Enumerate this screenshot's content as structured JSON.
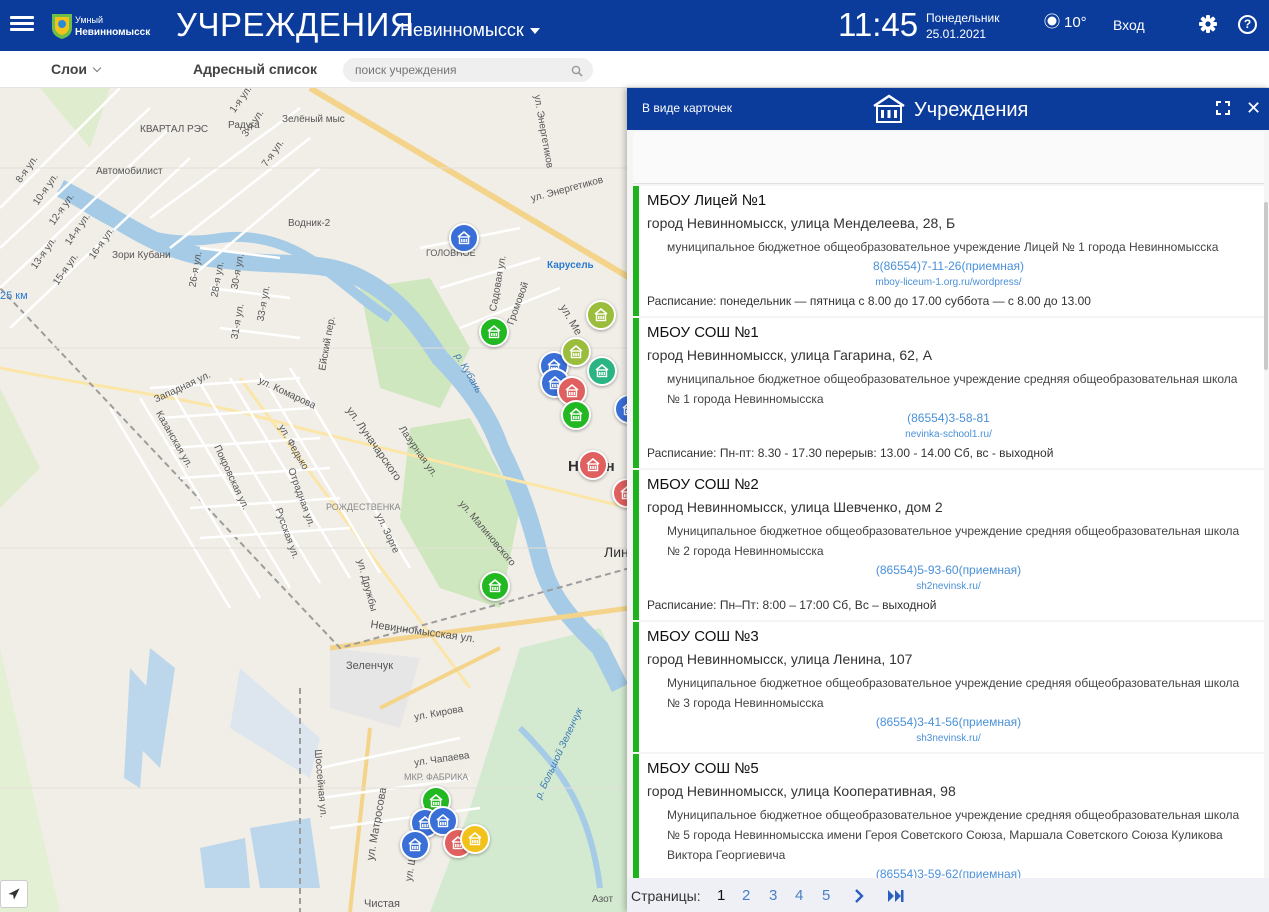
{
  "header": {
    "logo_line1": "Умный",
    "logo_line2": "Невинномысск",
    "title": "УЧРЕЖДЕНИЯ",
    "city": "Невинномысск",
    "time": "11:45",
    "weekday": "Понедельник",
    "date": "25.01.2021",
    "temperature": "10°",
    "login": "Вход",
    "help": "?"
  },
  "toolbar": {
    "layers_label": "Слои",
    "address_list_label": "Адресный список",
    "search_placeholder": "поиск учреждения"
  },
  "panel": {
    "view_mode": "В виде карточек",
    "title": "Учреждения",
    "cards": [
      {
        "name": "МБОУ Лицей №1",
        "address": "город Невинномысск, улица Менделеева, 28, Б",
        "full_name": "муниципальное бюджетное общеобразовательное учреждение Лицей № 1 города Невинномысска",
        "phone": "8(86554)7-11-26(приемная)",
        "site": "mboy-liceum-1.org.ru/wordpress/",
        "schedule": "Расписание: понедельник — пятница с 8.00 до 17.00 суббота — с 8.00 до 13.00"
      },
      {
        "name": "МБОУ СОШ №1",
        "address": "город Невинномысск, улица Гагарина, 62, А",
        "full_name": "муниципальное бюджетное общеобразовательное учреждение средняя общеобразовательная школа № 1 города Невинномысска",
        "phone": "(86554)3-58-81",
        "site": "nevinka-school1.ru/",
        "schedule": "Расписание: Пн-пт: 8.30 - 17.30 перерыв: 13.00 - 14.00 Сб, вс - выходной"
      },
      {
        "name": "МБОУ СОШ №2",
        "address": "город Невинномысск, улица Шевченко, дом 2",
        "full_name": "Муниципальное бюджетное общеобразовательное учреждение средняя общеобразовательная школа № 2 города Невинномысска",
        "phone": "(86554)5-93-60(приемная)",
        "site": "sh2nevinsk.ru/",
        "schedule": "Расписание: Пн–Пт: 8:00 – 17:00 Сб, Вс – выходной"
      },
      {
        "name": "МБОУ СОШ №3",
        "address": "город Невинномысск, улица Ленина, 107",
        "full_name": "Муниципальное бюджетное общеобразовательное учреждение средняя общеобразовательная школа № 3 города Невинномысска",
        "phone": "(86554)3-41-56(приемная)",
        "site": "sh3nevinsk.ru/",
        "schedule": ""
      },
      {
        "name": "МБОУ СОШ №5",
        "address": "город Невинномысск, улица Кооперативная, 98",
        "full_name": "Муниципальное бюджетное общеобразовательное учреждение средняя общеобразовательная школа № 5 города Невинномысска имени Героя Советского Союза, Маршала Советского Союза Куликова Виктора Георгиевича",
        "phone": "(86554)3-59-62(приемная)",
        "site": "",
        "schedule": ""
      }
    ],
    "pager": {
      "label": "Страницы:",
      "pages": [
        "1",
        "2",
        "3",
        "4",
        "5"
      ],
      "current": "1"
    }
  },
  "map": {
    "labels": [
      "КВАРТАЛ РЭС",
      "Радуга",
      "Зелёный мыс",
      "Автомобилист",
      "Водник-2",
      "Зори Кубани",
      "ГОЛОВНОЕ",
      "Карусель",
      "ул. Энергетиков",
      "Садовая ул.",
      "Громовой",
      "р. Кубань",
      "Западная ул.",
      "ул. Комарова",
      "ул. Луначарского",
      "Лазурная ул.",
      "РОЖДЕСТВЕНКА",
      "ул. Малиновского",
      "Невинномысская ул.",
      "Зеленчук",
      "ул. Кирова",
      "ул. Чапаева",
      "МКР. ФАБРИКА",
      "ул. Матросова",
      "р. Большой Зеленчук",
      "Шоссейная ул.",
      "Чистая",
      "25 км",
      "Ейский пер.",
      "Невин",
      "Лин",
      "Азот",
      "ул. Шев",
      "ул. Ме",
      "Русская ул.",
      "Казанская ул.",
      "Покровская ул.",
      "Отрадная ул.",
      "ул. Федько",
      "ул. Зорге",
      "ул. Дружбы",
      "8-я ул.",
      "10-я ул.",
      "12-я ул.",
      "13-я ул.",
      "14-я ул.",
      "15-я ул.",
      "16-я ул.",
      "1-я ул.",
      "3-я ул.",
      "7-я ул.",
      "26-я ул.",
      "28-я ул.",
      "30-я ул.",
      "31-я ул.",
      "33-я ул.",
      "ул. Энергетиков"
    ],
    "marker_colors": {
      "green": "#22b822",
      "blue": "#3a6fd8",
      "olive": "#9bbd3c",
      "red": "#e06060",
      "yellow": "#f2c21a",
      "teal": "#2bb584",
      "purple": "#9b59d0"
    }
  }
}
